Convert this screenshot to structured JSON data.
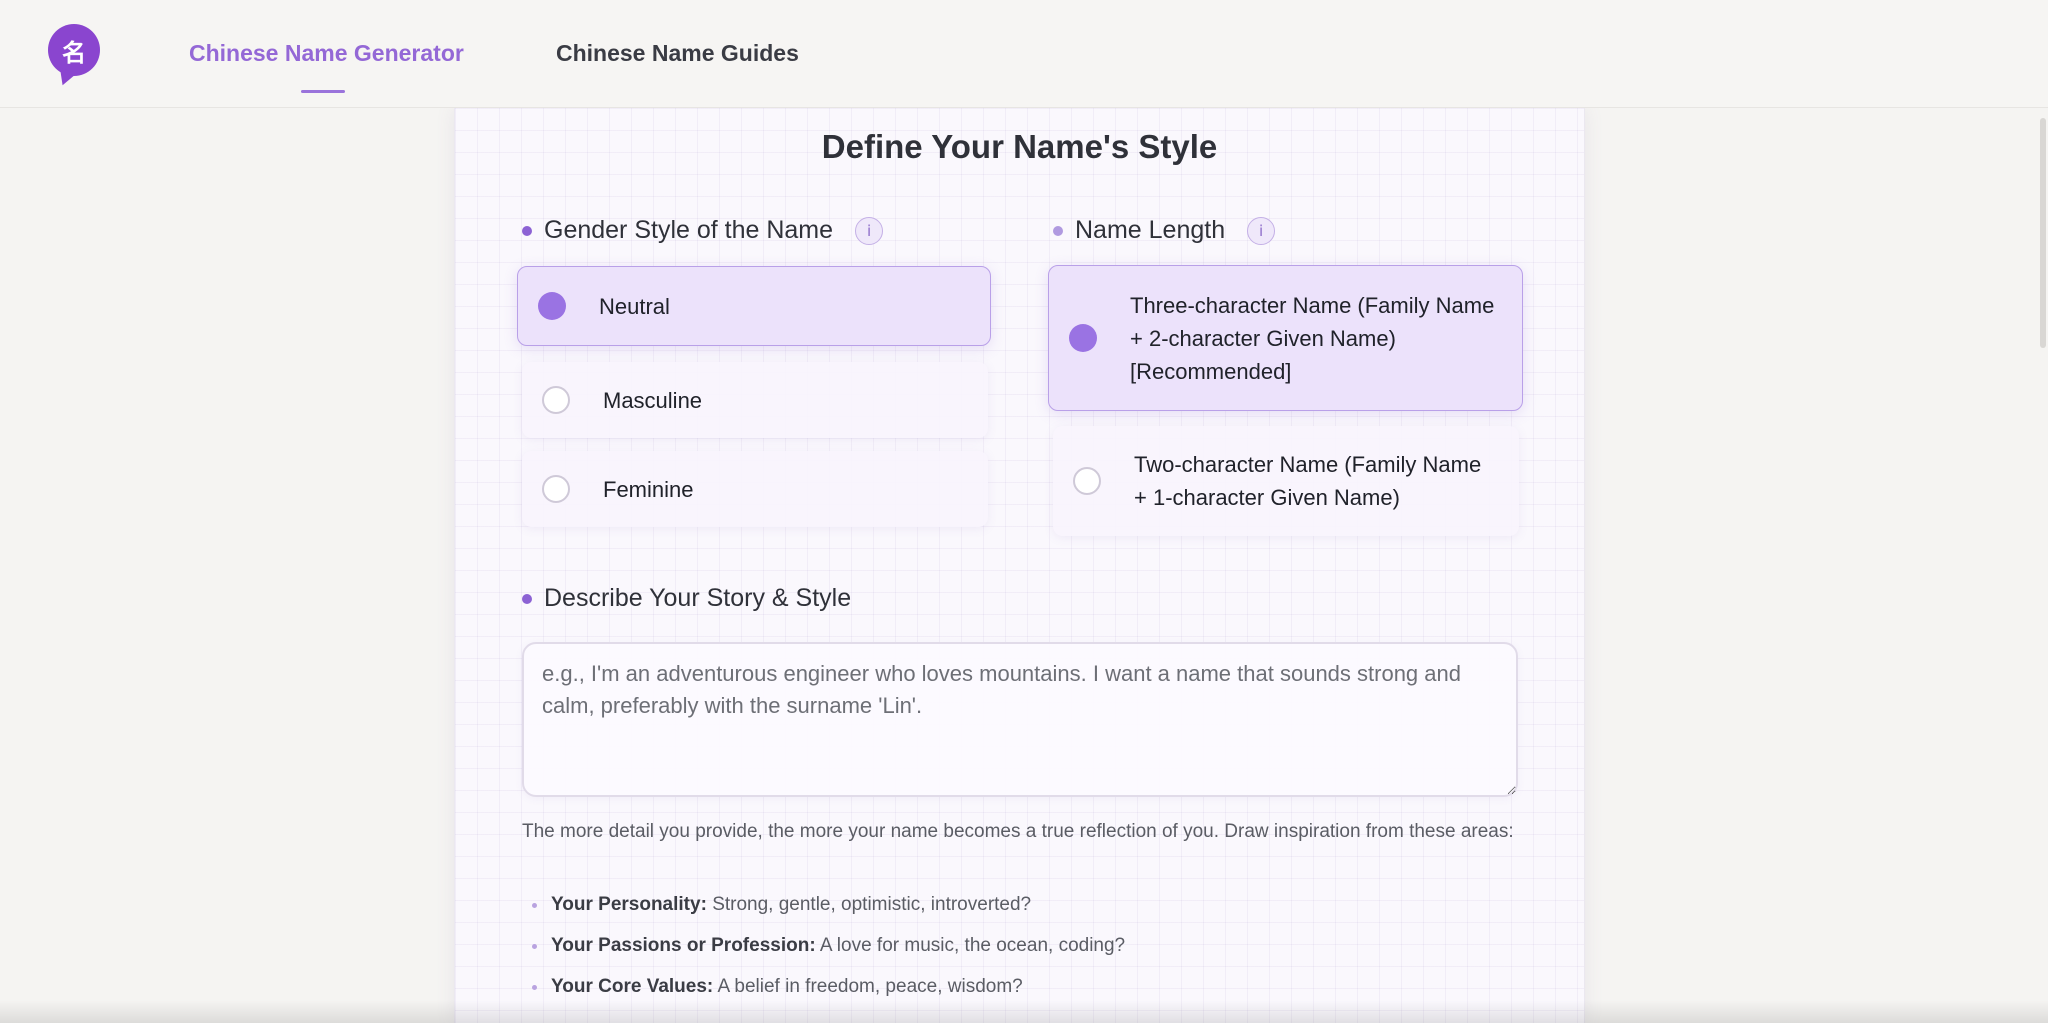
{
  "header": {
    "logo_glyph": "名",
    "nav": [
      {
        "label": "Chinese Name Generator",
        "active": true
      },
      {
        "label": "Chinese Name Guides",
        "active": false
      }
    ]
  },
  "card": {
    "title": "Define Your Name's Style",
    "gender": {
      "label": "Gender Style of the Name",
      "info_glyph": "i",
      "options": [
        {
          "label": "Neutral",
          "selected": true
        },
        {
          "label": "Masculine",
          "selected": false
        },
        {
          "label": "Feminine",
          "selected": false
        }
      ]
    },
    "length": {
      "label": "Name Length",
      "info_glyph": "i",
      "options": [
        {
          "label": "Three-character Name (Family Name + 2-character Given Name) [Recommended]",
          "selected": true
        },
        {
          "label": "Two-character Name (Family Name + 1-character Given Name)",
          "selected": false
        }
      ]
    },
    "story": {
      "label": "Describe Your Story & Style",
      "placeholder": "e.g., I'm an adventurous engineer who loves mountains. I want a name that sounds strong and calm, preferably with the surname 'Lin'.",
      "value": ""
    },
    "hint": "The more detail you provide, the more your name becomes a true reflection of you. Draw inspiration from these areas:",
    "inspirations": [
      {
        "title": "Your Personality:",
        "text": "Strong, gentle, optimistic, introverted?"
      },
      {
        "title": "Your Passions or Profession:",
        "text": "A love for music, the ocean, coding?"
      },
      {
        "title": "Your Core Values:",
        "text": "A belief in freedom, peace, wisdom?"
      }
    ]
  },
  "colors": {
    "accent": "#9468d6",
    "logo": "#8a45cf",
    "radio_selected": "#9a73e3",
    "selected_bg": "#ece2fb"
  }
}
